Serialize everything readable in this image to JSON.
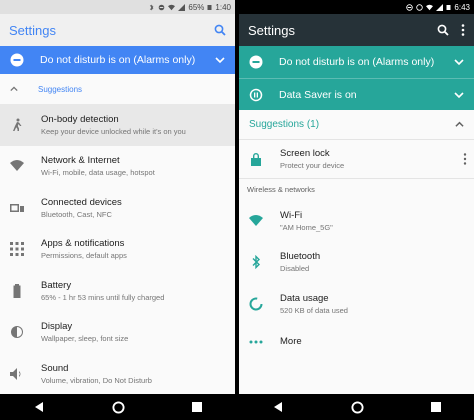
{
  "left": {
    "status": {
      "battery": "65%",
      "time": "1:40"
    },
    "app_title": "Settings",
    "banner": "Do not disturb is on (Alarms only)",
    "suggestions_label": "Suggestions",
    "items": [
      {
        "title": "On-body detection",
        "subtitle": "Keep your device unlocked while it's on you",
        "icon": "walking-person-icon"
      },
      {
        "title": "Network & Internet",
        "subtitle": "Wi-Fi, mobile, data usage, hotspot",
        "icon": "wifi-icon"
      },
      {
        "title": "Connected devices",
        "subtitle": "Bluetooth, Cast, NFC",
        "icon": "devices-icon"
      },
      {
        "title": "Apps & notifications",
        "subtitle": "Permissions, default apps",
        "icon": "apps-icon"
      },
      {
        "title": "Battery",
        "subtitle": "65% - 1 hr 53 mins until fully charged",
        "icon": "battery-icon"
      },
      {
        "title": "Display",
        "subtitle": "Wallpaper, sleep, font size",
        "icon": "display-icon"
      },
      {
        "title": "Sound",
        "subtitle": "Volume, vibration, Do Not Disturb",
        "icon": "sound-icon"
      }
    ]
  },
  "right": {
    "status": {
      "time": "6:43"
    },
    "app_title": "Settings",
    "banners": [
      {
        "text": "Do not disturb is on (Alarms only)",
        "icon": "dnd-icon"
      },
      {
        "text": "Data Saver is on",
        "icon": "data-saver-icon"
      }
    ],
    "suggestions_label": "Suggestions (1)",
    "suggestion": {
      "title": "Screen lock",
      "subtitle": "Protect your device",
      "icon": "lock-icon"
    },
    "section_label": "Wireless & networks",
    "items": [
      {
        "title": "Wi-Fi",
        "subtitle": "\"AM Home_5G\"",
        "icon": "wifi-icon"
      },
      {
        "title": "Bluetooth",
        "subtitle": "Disabled",
        "icon": "bluetooth-icon"
      },
      {
        "title": "Data usage",
        "subtitle": "520 KB of data used",
        "icon": "data-usage-icon"
      },
      {
        "title": "More",
        "subtitle": "",
        "icon": "more-icon"
      }
    ]
  },
  "colors": {
    "left_accent": "#4285f4",
    "right_accent": "#26a69a",
    "right_appbar": "#263238"
  }
}
